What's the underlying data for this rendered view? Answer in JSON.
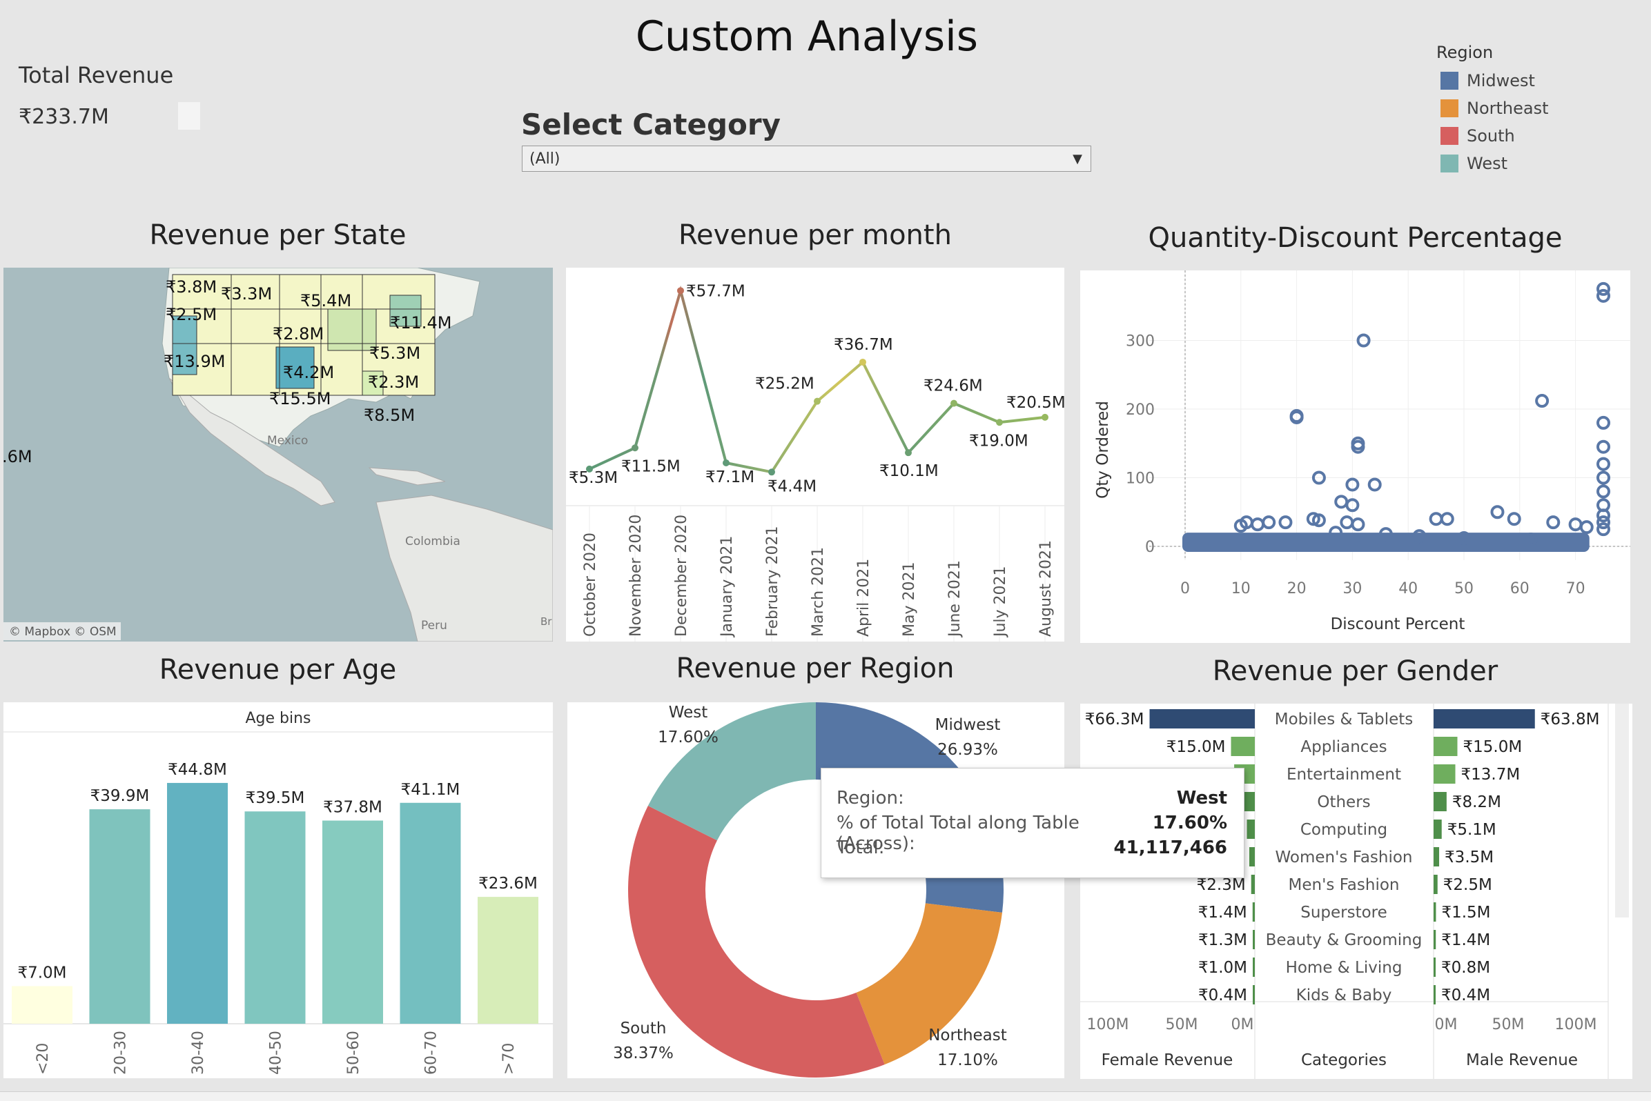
{
  "dashboard": {
    "title": "Custom Analysis",
    "kpi": {
      "label": "Total Revenue",
      "value": "₹233.7M"
    },
    "filter": {
      "label": "Select Category",
      "value": "(All)"
    },
    "region_legend": {
      "title": "Region",
      "items": [
        {
          "name": "Midwest",
          "color": "#5676a4"
        },
        {
          "name": "Northeast",
          "color": "#e4923b"
        },
        {
          "name": "South",
          "color": "#d65f5f"
        },
        {
          "name": "West",
          "color": "#7fb7b2"
        }
      ]
    }
  },
  "map": {
    "title": "Revenue per State",
    "labels": [
      "₹3.8M",
      "₹3.3M",
      "₹2.5M",
      "₹5.4M",
      "₹11.4M",
      "₹2.8M",
      "₹5.3M",
      "₹13.9M",
      "₹4.2M",
      "₹2.3M",
      "₹15.5M",
      "₹8.5M",
      ".6M"
    ],
    "place_names": [
      "Mexico",
      "Colombia",
      "Peru",
      "Br"
    ],
    "attribution": "© Mapbox  © OSM"
  },
  "tooltip": {
    "region_label": "Region:",
    "region_value": "West",
    "pct_label": "% of Total Total along Table (Across):",
    "pct_value": "17.60%",
    "total_label": "Total:",
    "total_value": "41,117,466"
  },
  "chart_data": [
    {
      "type": "line",
      "title": "Revenue per month",
      "categories": [
        "October 2020",
        "November 2020",
        "December 2020",
        "January 2021",
        "February 2021",
        "March 2021",
        "April 2021",
        "May 2021",
        "June 2021",
        "July 2021",
        "August 2021"
      ],
      "values": [
        5.3,
        11.5,
        57.7,
        7.1,
        4.4,
        25.2,
        36.7,
        10.1,
        24.6,
        19.0,
        20.5
      ],
      "labels": [
        "₹5.3M",
        "₹11.5M",
        "₹57.7M",
        "₹7.1M",
        "₹4.4M",
        "₹25.2M",
        "₹36.7M",
        "₹10.1M",
        "₹24.6M",
        "₹19.0M",
        "₹20.5M"
      ],
      "ylim": [
        0,
        60
      ]
    },
    {
      "type": "scatter",
      "title": "Quantity-Discount Percentage",
      "xlabel": "Discount Percent",
      "ylabel": "Qty Ordered",
      "xlim": [
        0,
        75
      ],
      "ylim": [
        0,
        380
      ],
      "xticks": [
        0,
        10,
        20,
        30,
        40,
        50,
        60,
        70
      ],
      "yticks": [
        0,
        100,
        200,
        300
      ],
      "points": [
        [
          75,
          375
        ],
        [
          75,
          365
        ],
        [
          32,
          300
        ],
        [
          64,
          212
        ],
        [
          20,
          190
        ],
        [
          20,
          188
        ],
        [
          31,
          150
        ],
        [
          31,
          145
        ],
        [
          75,
          180
        ],
        [
          75,
          145
        ],
        [
          75,
          120
        ],
        [
          75,
          100
        ],
        [
          75,
          80
        ],
        [
          75,
          60
        ],
        [
          75,
          45
        ],
        [
          75,
          35
        ],
        [
          75,
          25
        ],
        [
          24,
          100
        ],
        [
          30,
          90
        ],
        [
          34,
          90
        ],
        [
          28,
          65
        ],
        [
          30,
          60
        ],
        [
          18,
          35
        ],
        [
          10,
          30
        ],
        [
          11,
          35
        ],
        [
          13,
          32
        ],
        [
          15,
          35
        ],
        [
          23,
          40
        ],
        [
          24,
          38
        ],
        [
          29,
          35
        ],
        [
          31,
          32
        ],
        [
          45,
          40
        ],
        [
          47,
          40
        ],
        [
          56,
          50
        ],
        [
          59,
          40
        ],
        [
          66,
          35
        ],
        [
          70,
          32
        ],
        [
          72,
          28
        ],
        [
          27,
          20
        ],
        [
          36,
          18
        ],
        [
          42,
          15
        ],
        [
          50,
          12
        ],
        [
          62,
          10
        ]
      ],
      "dense_band": {
        "x": [
          0,
          72
        ],
        "y": [
          0,
          20
        ]
      }
    },
    {
      "type": "bar",
      "title": "Revenue per Age",
      "header": "Age bins",
      "categories": [
        "<20",
        "20-30",
        "30-40",
        "40-50",
        "50-60",
        "60-70",
        ">70"
      ],
      "values": [
        7.0,
        39.9,
        44.8,
        39.5,
        37.8,
        41.1,
        23.6
      ],
      "labels": [
        "₹7.0M",
        "₹39.9M",
        "₹44.8M",
        "₹39.5M",
        "₹37.8M",
        "₹41.1M",
        "₹23.6M"
      ],
      "colors": [
        "#ffffe0",
        "#7fc3bd",
        "#62b2c1",
        "#80c6bf",
        "#86cbbf",
        "#74bfc0",
        "#d7edb8"
      ],
      "ylim": [
        0,
        48
      ]
    },
    {
      "type": "pie",
      "title": "Revenue per Region",
      "slices": [
        {
          "name": "Midwest",
          "pct": 26.93,
          "label": "26.93%",
          "color": "#5676a4"
        },
        {
          "name": "Northeast",
          "pct": 17.1,
          "label": "17.10%",
          "color": "#e4923b"
        },
        {
          "name": "South",
          "pct": 38.37,
          "label": "38.37%",
          "color": "#d65f5f"
        },
        {
          "name": "West",
          "pct": 17.6,
          "label": "17.60%",
          "color": "#7fb7b2"
        }
      ]
    },
    {
      "type": "bar",
      "title": "Revenue per Gender",
      "categories": [
        "Mobiles & Tablets",
        "Appliances",
        "Entertainment",
        "Others",
        "Computing",
        "Women's Fashion",
        "Men's Fashion",
        "Superstore",
        "Beauty & Grooming",
        "Home & Living",
        "Kids & Baby"
      ],
      "series": [
        {
          "name": "Female Revenue",
          "values": [
            66.3,
            15.0,
            13.0,
            8.0,
            5.0,
            3.5,
            2.3,
            1.4,
            1.3,
            1.0,
            0.4
          ],
          "labels": [
            "₹66.3M",
            "₹15.0M",
            "",
            "",
            "",
            "",
            "₹2.3M",
            "₹1.4M",
            "₹1.3M",
            "₹1.0M",
            "₹0.4M"
          ]
        },
        {
          "name": "Male Revenue",
          "values": [
            63.8,
            15.0,
            13.7,
            8.2,
            5.1,
            3.5,
            2.5,
            1.5,
            1.4,
            0.8,
            0.4
          ],
          "labels": [
            "₹63.8M",
            "₹15.0M",
            "₹13.7M",
            "₹8.2M",
            "₹5.1M",
            "₹3.5M",
            "₹2.5M",
            "₹1.5M",
            "₹1.4M",
            "₹0.8M",
            "₹0.4M"
          ]
        }
      ],
      "center_header": "Categories",
      "female_ticks": [
        "100M",
        "50M",
        "0M"
      ],
      "male_ticks": [
        "0M",
        "50M",
        "100M"
      ],
      "xlim": [
        0,
        110
      ]
    }
  ]
}
